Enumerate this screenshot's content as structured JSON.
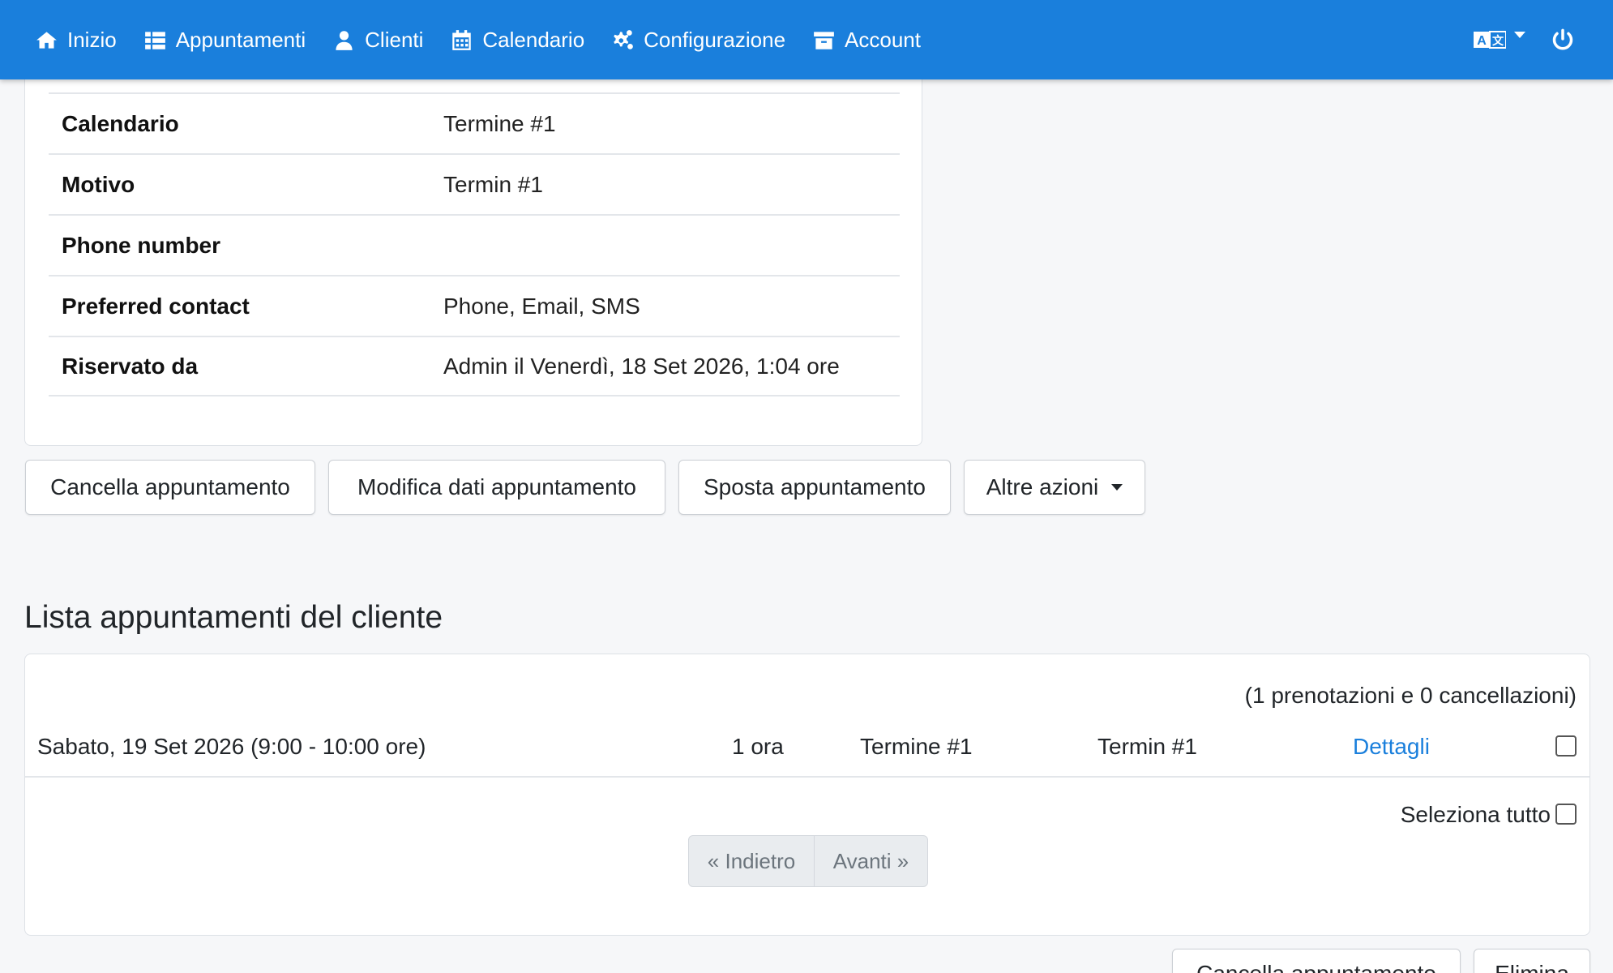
{
  "nav": {
    "items": [
      {
        "label": "Inizio",
        "icon": "home-icon"
      },
      {
        "label": "Appuntamenti",
        "icon": "list-icon"
      },
      {
        "label": "Clienti",
        "icon": "user-icon"
      },
      {
        "label": "Calendario",
        "icon": "calendar-icon"
      },
      {
        "label": "Configurazione",
        "icon": "gears-icon"
      },
      {
        "label": "Account",
        "icon": "archive-icon"
      }
    ],
    "language_icon": "language-icon",
    "power_icon": "power-icon",
    "background_color": "#1a7fdc"
  },
  "details": {
    "rows": [
      {
        "label": "Calendario",
        "value": "Termine #1"
      },
      {
        "label": "Motivo",
        "value": "Termin #1"
      },
      {
        "label": "Phone number",
        "value": ""
      },
      {
        "label": "Preferred contact",
        "value": "Phone, Email, SMS"
      },
      {
        "label": "Riservato da",
        "value": "Admin il Venerdì, 18 Set 2026, 1:04 ore"
      }
    ]
  },
  "actions": {
    "cancel": "Cancella appuntamento",
    "edit": "Modifica dati appuntamento",
    "move": "Sposta appuntamento",
    "more": "Altre azioni"
  },
  "list": {
    "title": "Lista appuntamenti del cliente",
    "summary": "(1 prenotazioni e 0 cancellazioni)",
    "rows": [
      {
        "datetime": "Sabato, 19 Set 2026 (9:00 - 10:00 ore)",
        "duration": "1 ora",
        "calendar": "Termine #1",
        "reason": "Termin #1",
        "details_link": "Dettagli"
      }
    ],
    "select_all": "Seleziona tutto",
    "pager": {
      "prev": "« Indietro",
      "next": "Avanti »"
    }
  },
  "bottom_actions": {
    "cancel": "Cancella appuntamento",
    "delete": "Elimina"
  }
}
